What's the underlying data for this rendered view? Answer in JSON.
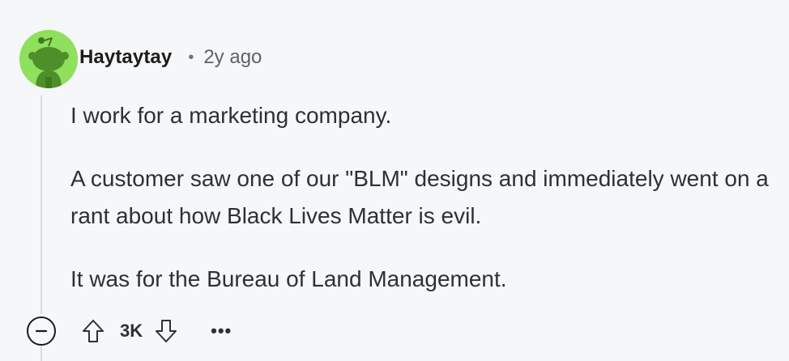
{
  "comment": {
    "author": "Haytaytay",
    "separator": "•",
    "time_ago": "2y ago",
    "paragraphs": [
      "I work for a marketing company.",
      "A customer saw one of our \"BLM\" designs and immediately went on a rant about how Black Lives Matter is evil.",
      "It was for the Bureau of Land Management."
    ],
    "score": "3K",
    "more_label": "•••"
  },
  "icons": {
    "avatar": "reddit-snoo-avatar",
    "collapse": "minus-circle-icon",
    "upvote": "arrow-up-icon",
    "downvote": "arrow-down-icon"
  },
  "colors": {
    "background": "#f6f7f8",
    "avatar_bg": "#8fe05d",
    "text": "#2a3236",
    "thread_line": "#d8dde0"
  }
}
